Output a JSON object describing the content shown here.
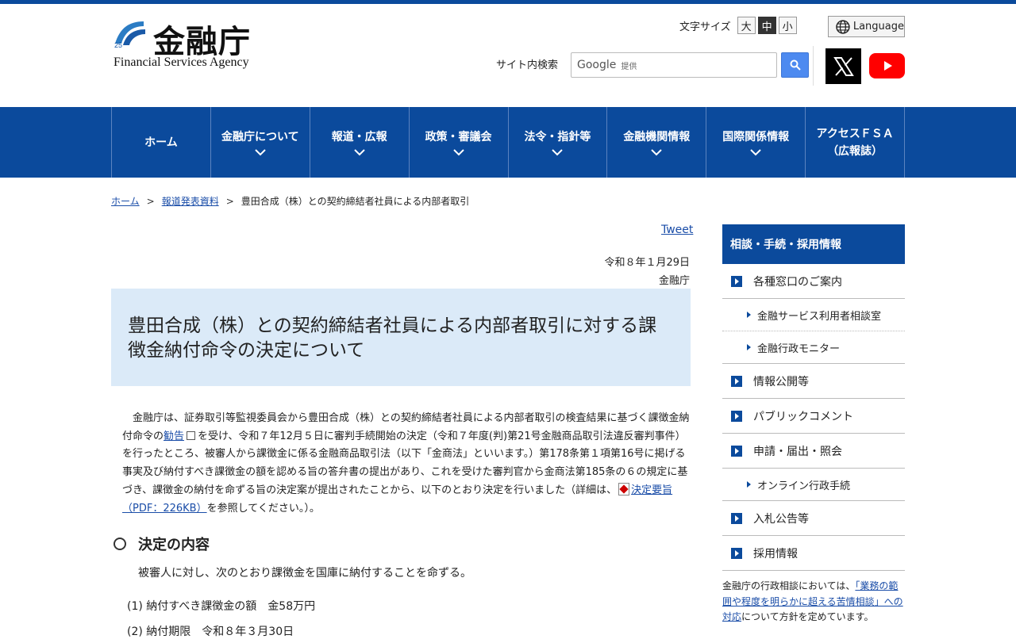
{
  "header": {
    "logo_jp": "金融庁",
    "logo_en": "Financial Services Agency",
    "font_size_label": "文字サイズ",
    "font_sizes": [
      "大",
      "中",
      "小"
    ],
    "font_size_selected": "中",
    "language_label": "Language",
    "search_label": "サイト内検索",
    "search_google": "Google",
    "search_powered": "提供"
  },
  "nav": {
    "items": [
      {
        "label": "ホーム",
        "dropdown": false
      },
      {
        "label": "金融庁について",
        "dropdown": true
      },
      {
        "label": "報道・広報",
        "dropdown": true
      },
      {
        "label": "政策・審議会",
        "dropdown": true
      },
      {
        "label": "法令・指針等",
        "dropdown": true
      },
      {
        "label": "金融機関情報",
        "dropdown": true
      },
      {
        "label": "国際関係情報",
        "dropdown": true
      },
      {
        "label": "アクセスＦＳＡ",
        "label2": "（広報誌）",
        "dropdown": false
      }
    ]
  },
  "breadcrumb": {
    "home": "ホーム",
    "press": "報道発表資料",
    "current": "豊田合成（株）との契約締結者社員による内部者取引",
    "sep": ">"
  },
  "article": {
    "tweet": "Tweet",
    "date": "令和８年１月29日",
    "agency": "金融庁",
    "title": "豊田合成（株）との契約締結者社員による内部者取引に対する課徴金納付命令の決定について",
    "body_1": "金融庁は、証券取引等監視委員会から豊田合成（株）との契約締結者社員による内部者取引の検査結果に基づく課徴金納付命令の",
    "body_link1": "勧告",
    "body_2": "を受け、令和７年12月５日に審判手続開始の決定（令和７年度(判)第21号金融商品取引法違反審判事件）を行ったところ、被審人から課徴金に係る金融商品取引法（以下「金商法」といいます。）第178条第１項第16号に掲げる事実及び納付すべき課徴金の額を認める旨の答弁書の提出があり、これを受けた審判官から金商法第185条の６の規定に基づき、課徴金の納付を命ずる旨の決定案が提出されたことから、以下のとおり決定を行いました（詳細は、",
    "body_link2": "決定要旨（PDF：226KB）",
    "body_3": "を参照してください。）。",
    "section_heading": "決定の内容",
    "order_text": "被審人に対し、次のとおり課徴金を国庫に納付することを命ずる。",
    "item1": "(1) 納付すべき課徴金の額　金58万円",
    "item2": "(2) 納付期限　令和８年３月30日"
  },
  "sidebar": {
    "heading": "相談・手続・採用情報",
    "items": {
      "window": "各種窓口のご案内",
      "sub_consult": "金融サービス利用者相談室",
      "sub_monitor": "金融行政モニター",
      "disclosure": "情報公開等",
      "public_comment": "パブリックコメント",
      "application": "申請・届出・照会",
      "sub_online": "オンライン行政手続",
      "bid": "入札公告等",
      "recruit": "採用情報"
    },
    "note_1": "金融庁の行政相談においては、",
    "note_link": "「業務の範囲や程度を明らかに超える苦情相談」への対応",
    "note_2": "について方針を定めています。"
  },
  "colors": {
    "brand_blue": "#0b4a9c",
    "title_bg": "#dbeaf8",
    "link": "#1a4da8"
  }
}
